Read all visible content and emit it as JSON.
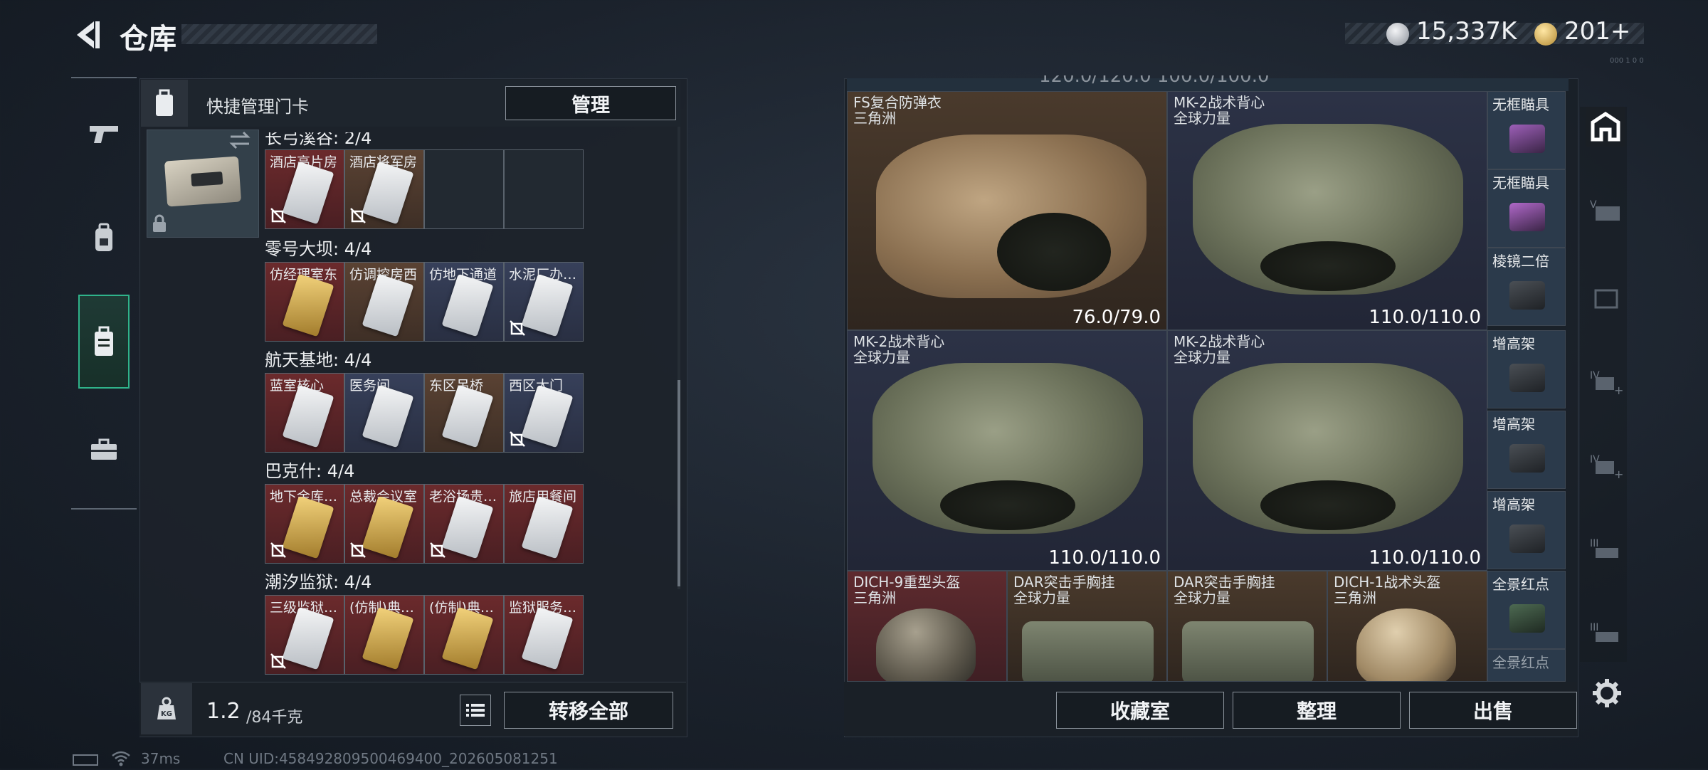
{
  "header": {
    "title": "仓库"
  },
  "currency": {
    "silver": "15,337K",
    "gold": "201+",
    "tiny": "000 1 0 0"
  },
  "quick_manage": {
    "label": "快捷管理门卡",
    "manage_button": "管理"
  },
  "groups": [
    {
      "title": "长弓溪谷: 2/4",
      "slots": [
        {
          "name": "酒店高片房",
          "bg": "red",
          "card": "white",
          "nofav": true
        },
        {
          "name": "酒店将军房",
          "bg": "brown",
          "card": "white",
          "nofav": true
        },
        {
          "name": "",
          "bg": "empty",
          "card": "",
          "nofav": false
        },
        {
          "name": "",
          "bg": "empty",
          "card": "",
          "nofav": false
        }
      ]
    },
    {
      "title": "零号大坝: 4/4",
      "slots": [
        {
          "name": "仿经理室东",
          "bg": "red",
          "card": "gold",
          "nofav": false
        },
        {
          "name": "仿调控房西",
          "bg": "brown",
          "card": "white",
          "nofav": false
        },
        {
          "name": "仿地下通道",
          "bg": "blue",
          "card": "white",
          "nofav": false
        },
        {
          "name": "水泥厂办…",
          "bg": "blue",
          "card": "white",
          "nofav": true
        }
      ]
    },
    {
      "title": "航天基地: 4/4",
      "slots": [
        {
          "name": "蓝室核心",
          "bg": "red",
          "card": "white",
          "nofav": false
        },
        {
          "name": "医务间",
          "bg": "blue",
          "card": "white",
          "nofav": false
        },
        {
          "name": "东区吊桥",
          "bg": "brown",
          "card": "white",
          "nofav": false
        },
        {
          "name": "西区大门",
          "bg": "blue",
          "card": "white",
          "nofav": true
        }
      ]
    },
    {
      "title": "巴克什: 4/4",
      "slots": [
        {
          "name": "地下金库…",
          "bg": "red",
          "card": "gold",
          "nofav": true
        },
        {
          "name": "总裁会议室",
          "bg": "red",
          "card": "gold",
          "nofav": true
        },
        {
          "name": "老浴场贵…",
          "bg": "red",
          "card": "white",
          "nofav": true
        },
        {
          "name": "旅店用餐间",
          "bg": "red",
          "card": "white",
          "nofav": false
        }
      ]
    },
    {
      "title": "潮汐监狱: 4/4",
      "slots": [
        {
          "name": "三级监狱…",
          "bg": "red",
          "card": "white",
          "nofav": true
        },
        {
          "name": "(仿制)典…",
          "bg": "red",
          "card": "gold",
          "nofav": false
        },
        {
          "name": "(仿制)典…",
          "bg": "red",
          "card": "gold",
          "nofav": false
        },
        {
          "name": "监狱服务…",
          "bg": "red",
          "card": "white",
          "nofav": false
        }
      ]
    }
  ],
  "weight": {
    "current": "1.2",
    "max": "/84千克"
  },
  "transfer_button": "转移全部",
  "right_top_cut": "120.0/120.0         100.0/100.0",
  "items": {
    "fs_vest": {
      "name": "FS复合防弹衣",
      "origin": "三角洲",
      "durability": "76.0/79.0"
    },
    "mk2_a": {
      "name": "MK-2战术背心",
      "origin": "全球力量",
      "durability": "110.0/110.0"
    },
    "mk2_b": {
      "name": "MK-2战术背心",
      "origin": "全球力量",
      "durability": "110.0/110.0"
    },
    "mk2_c": {
      "name": "MK-2战术背心",
      "origin": "全球力量",
      "durability": "110.0/110.0"
    },
    "dich9": {
      "name": "DICH-9重型头盔",
      "origin": "三角洲"
    },
    "dar_a": {
      "name": "DAR突击手胸挂",
      "origin": "全球力量"
    },
    "dar_b": {
      "name": "DAR突击手胸挂",
      "origin": "全球力量"
    },
    "dich1": {
      "name": "DICH-1战术头盔",
      "origin": "三角洲"
    }
  },
  "small_items": [
    "无框瞄具",
    "无框瞄具",
    "棱镜二倍",
    "增高架",
    "增高架",
    "增高架",
    "全景红点",
    "全景红点"
  ],
  "buttons": {
    "collection": "收藏室",
    "sort": "整理",
    "sell": "出售"
  },
  "status": {
    "ping": "37ms",
    "uid": "CN UID:458492809500469400_202605081251"
  },
  "colors": {
    "accent_green": "#2fb38a",
    "slot_red": "#6b2a2c",
    "slot_brown": "#5a4233",
    "slot_blue": "#37405a"
  }
}
